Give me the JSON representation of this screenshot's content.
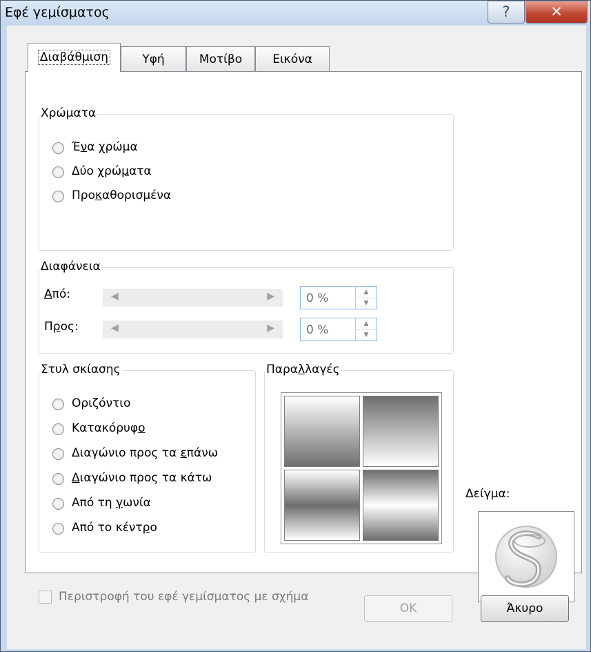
{
  "window": {
    "title": "Εφέ γεμίσματος",
    "help_glyph": "?",
    "close_glyph": "✕"
  },
  "tabs": [
    "Διαβάθμιση",
    "Υφή",
    "Μοτίβο",
    "Εικόνα"
  ],
  "colors_group": {
    "label": "Χρώματα",
    "options": [
      {
        "pre": "Έ",
        "u": "ν",
        "post": "α χρώμα"
      },
      {
        "pre": "Δύο χρώ",
        "u": "μ",
        "post": "ατα"
      },
      {
        "pre": "Προ",
        "u": "κ",
        "post": "αθορισμένα"
      }
    ]
  },
  "transparency": {
    "label": "Διαφάνεια",
    "from_label": {
      "u": "Α",
      "post": "πό:"
    },
    "to_label": {
      "pre": "Π",
      "u": "ρ",
      "post": "ος:"
    },
    "from_value": "0 %",
    "to_value": "0 %",
    "left_arrow": "◀",
    "right_arrow": "▶",
    "spin_up": "▲",
    "spin_down": "▼"
  },
  "shading": {
    "label": "Στυλ σκίασης",
    "options": [
      {
        "pre": "Οριζόντιο",
        "u": "",
        "post": ""
      },
      {
        "pre": "Κατακόρυφ",
        "u": "ο",
        "post": ""
      },
      {
        "pre": "Διαγώνιο προς τα ",
        "u": "ε",
        "post": "πάνω"
      },
      {
        "pre": "",
        "u": "Δ",
        "post": "ιαγώνιο προς τα κάτω"
      },
      {
        "pre": "Από τη ",
        "u": "γ",
        "post": "ωνία"
      },
      {
        "pre": "Από το κέντ",
        "u": "ρ",
        "post": "ο"
      }
    ]
  },
  "variants": {
    "pre": "Παρα",
    "u": "λ",
    "post": "λαγές"
  },
  "sample_label": "Δείγμα:",
  "rotate_checkbox": "Περιστροφή του εφέ γεμίσματος με σχήμα",
  "buttons": {
    "ok": "OK",
    "cancel": "Άκυρο"
  }
}
